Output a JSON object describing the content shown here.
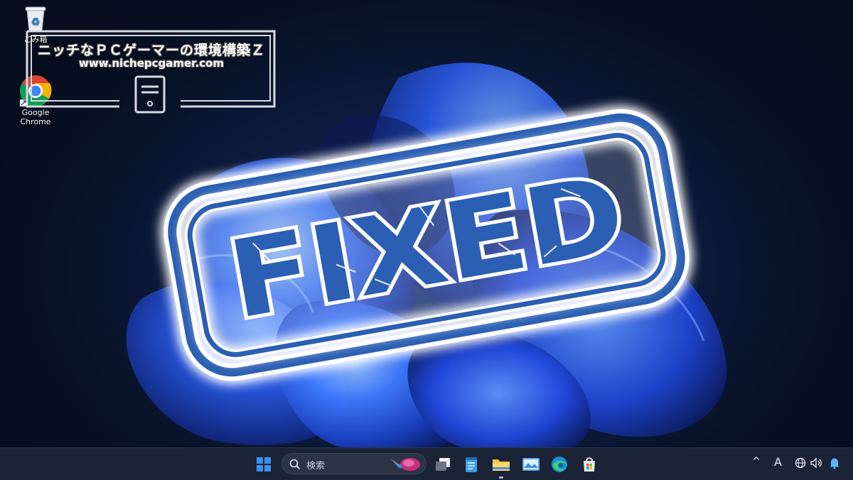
{
  "desktop": {
    "icons": [
      {
        "name": "recycle-bin",
        "label": "ごみ箱"
      },
      {
        "name": "google-chrome",
        "label": "Google Chrome"
      }
    ]
  },
  "watermark": {
    "title": "ニッチなＰＣゲーマーの環境構築Ｚ",
    "url": "www.nichepcgamer.com"
  },
  "stamp": {
    "text": "FIXED",
    "color": "#2b5fb3"
  },
  "taskbar": {
    "search_placeholder": "検索",
    "apps": [
      "start-icon",
      "search-box",
      "task-view-icon",
      "notepad-icon",
      "file-explorer-icon",
      "photos-icon",
      "edge-icon",
      "store-icon"
    ],
    "tray": {
      "chevron": "^",
      "ime": "A"
    },
    "colors": {
      "background": "#1b2336",
      "accent": "#3b8ef0"
    }
  }
}
